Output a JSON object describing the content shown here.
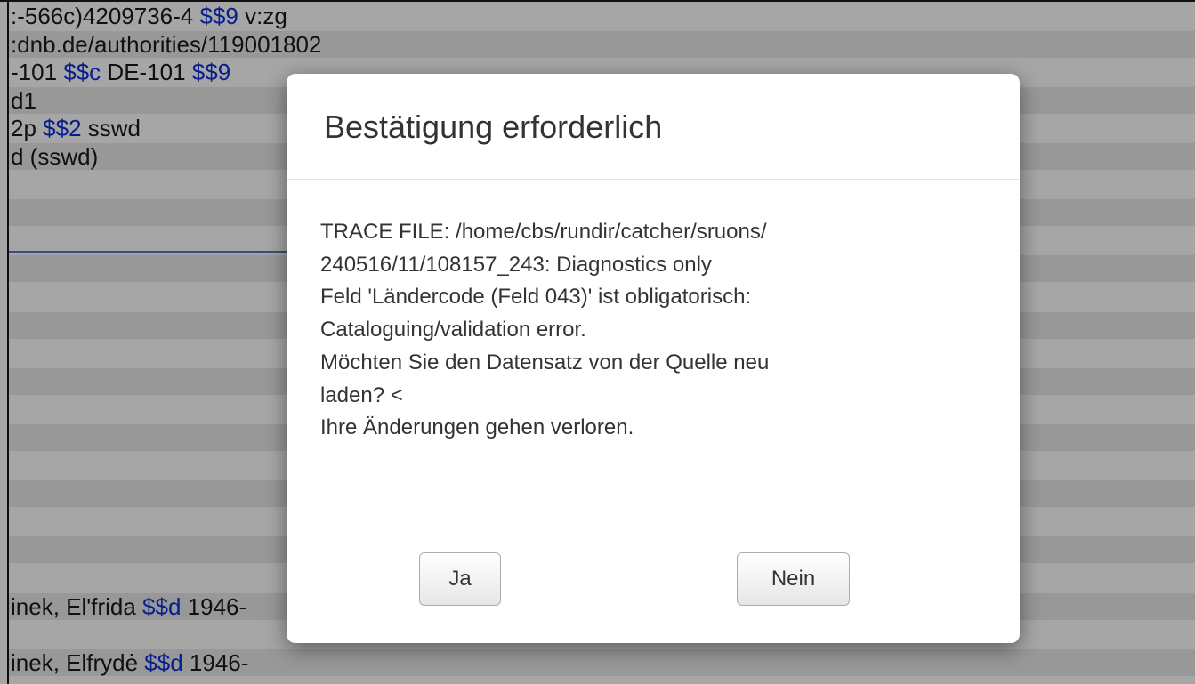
{
  "background": {
    "rows": [
      {
        "parts": [
          {
            "text": ":-566c)4209736-4 ",
            "sub": false
          },
          {
            "text": "$$9",
            "sub": true
          },
          {
            "text": " v:zg",
            "sub": false
          }
        ]
      },
      {
        "parts": [
          {
            "text": ":dnb.de/authorities/119001802",
            "sub": false
          }
        ]
      },
      {
        "parts": [
          {
            "text": "-101 ",
            "sub": false
          },
          {
            "text": "$$c",
            "sub": true
          },
          {
            "text": " DE-101 ",
            "sub": false
          },
          {
            "text": "$$9",
            "sub": true
          }
        ]
      },
      {
        "parts": [
          {
            "text": "d1",
            "sub": false
          }
        ]
      },
      {
        "parts": [
          {
            "text": "2p ",
            "sub": false
          },
          {
            "text": "$$2",
            "sub": true
          },
          {
            "text": " sswd",
            "sub": false
          }
        ]
      },
      {
        "parts": [
          {
            "text": "d (sswd)",
            "sub": false
          }
        ]
      },
      {
        "parts": []
      },
      {
        "parts": []
      },
      {
        "parts": []
      },
      {
        "parts": []
      },
      {
        "parts": []
      },
      {
        "parts": []
      },
      {
        "parts": []
      },
      {
        "parts": []
      },
      {
        "parts": []
      },
      {
        "parts": []
      },
      {
        "parts": []
      },
      {
        "parts": []
      },
      {
        "parts": []
      },
      {
        "parts": []
      },
      {
        "parts": []
      },
      {
        "parts": [
          {
            "text": "inek, El'frida ",
            "sub": false
          },
          {
            "text": "$$d",
            "sub": true
          },
          {
            "text": " 1946-",
            "sub": false
          }
        ]
      },
      {
        "parts": []
      },
      {
        "parts": [
          {
            "text": "inek, Elfrydė ",
            "sub": false
          },
          {
            "text": "$$d",
            "sub": true
          },
          {
            "text": " 1946-",
            "sub": false
          }
        ]
      }
    ]
  },
  "dialog": {
    "title": "Bestätigung erforderlich",
    "message_lines": [
      "TRACE FILE: /home/cbs/rundir/catcher/sruons/",
      "240516/11/108157_243: Diagnostics only",
      "Feld 'Ländercode (Feld 043)' ist obligatorisch:",
      "Cataloguing/validation error.",
      "Möchten Sie den Datensatz von der Quelle neu",
      "laden? <",
      "Ihre Änderungen gehen verloren."
    ],
    "yes_label": "Ja",
    "no_label": "Nein"
  },
  "colors": {
    "subfield_code": "#0b2fd6",
    "overlay": "rgba(0,0,0,0.35)",
    "button_border": "#adadad",
    "text": "#333333"
  }
}
